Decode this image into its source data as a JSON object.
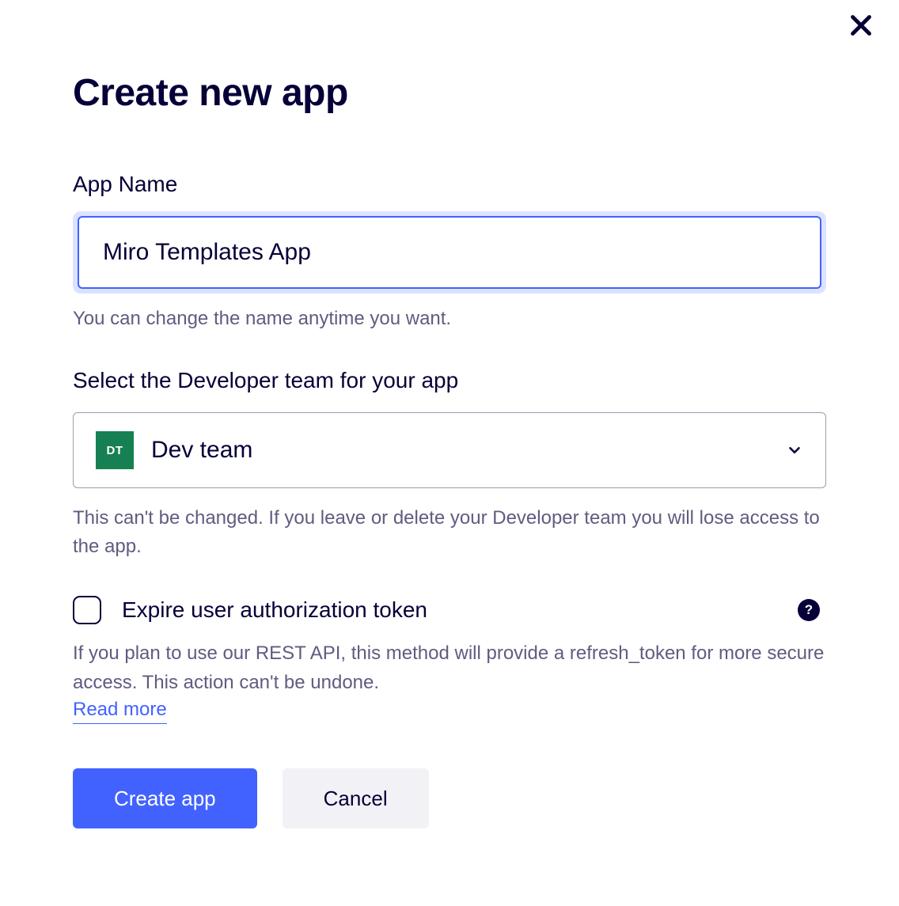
{
  "modal": {
    "title": "Create new app"
  },
  "appName": {
    "label": "App Name",
    "value": "Miro Templates App",
    "hint": "You can change the name anytime you want."
  },
  "team": {
    "label": "Select the Developer team for your app",
    "badge": "DT",
    "selected": "Dev team",
    "hint": "This can't be changed. If you leave or delete your Developer team you will lose access to the app."
  },
  "expire": {
    "label": "Expire user authorization token",
    "description": "If you plan to use our REST API, this method will provide a refresh_token for more secure access. This action can't be undone.",
    "linkText": "Read more"
  },
  "buttons": {
    "create": "Create app",
    "cancel": "Cancel"
  }
}
